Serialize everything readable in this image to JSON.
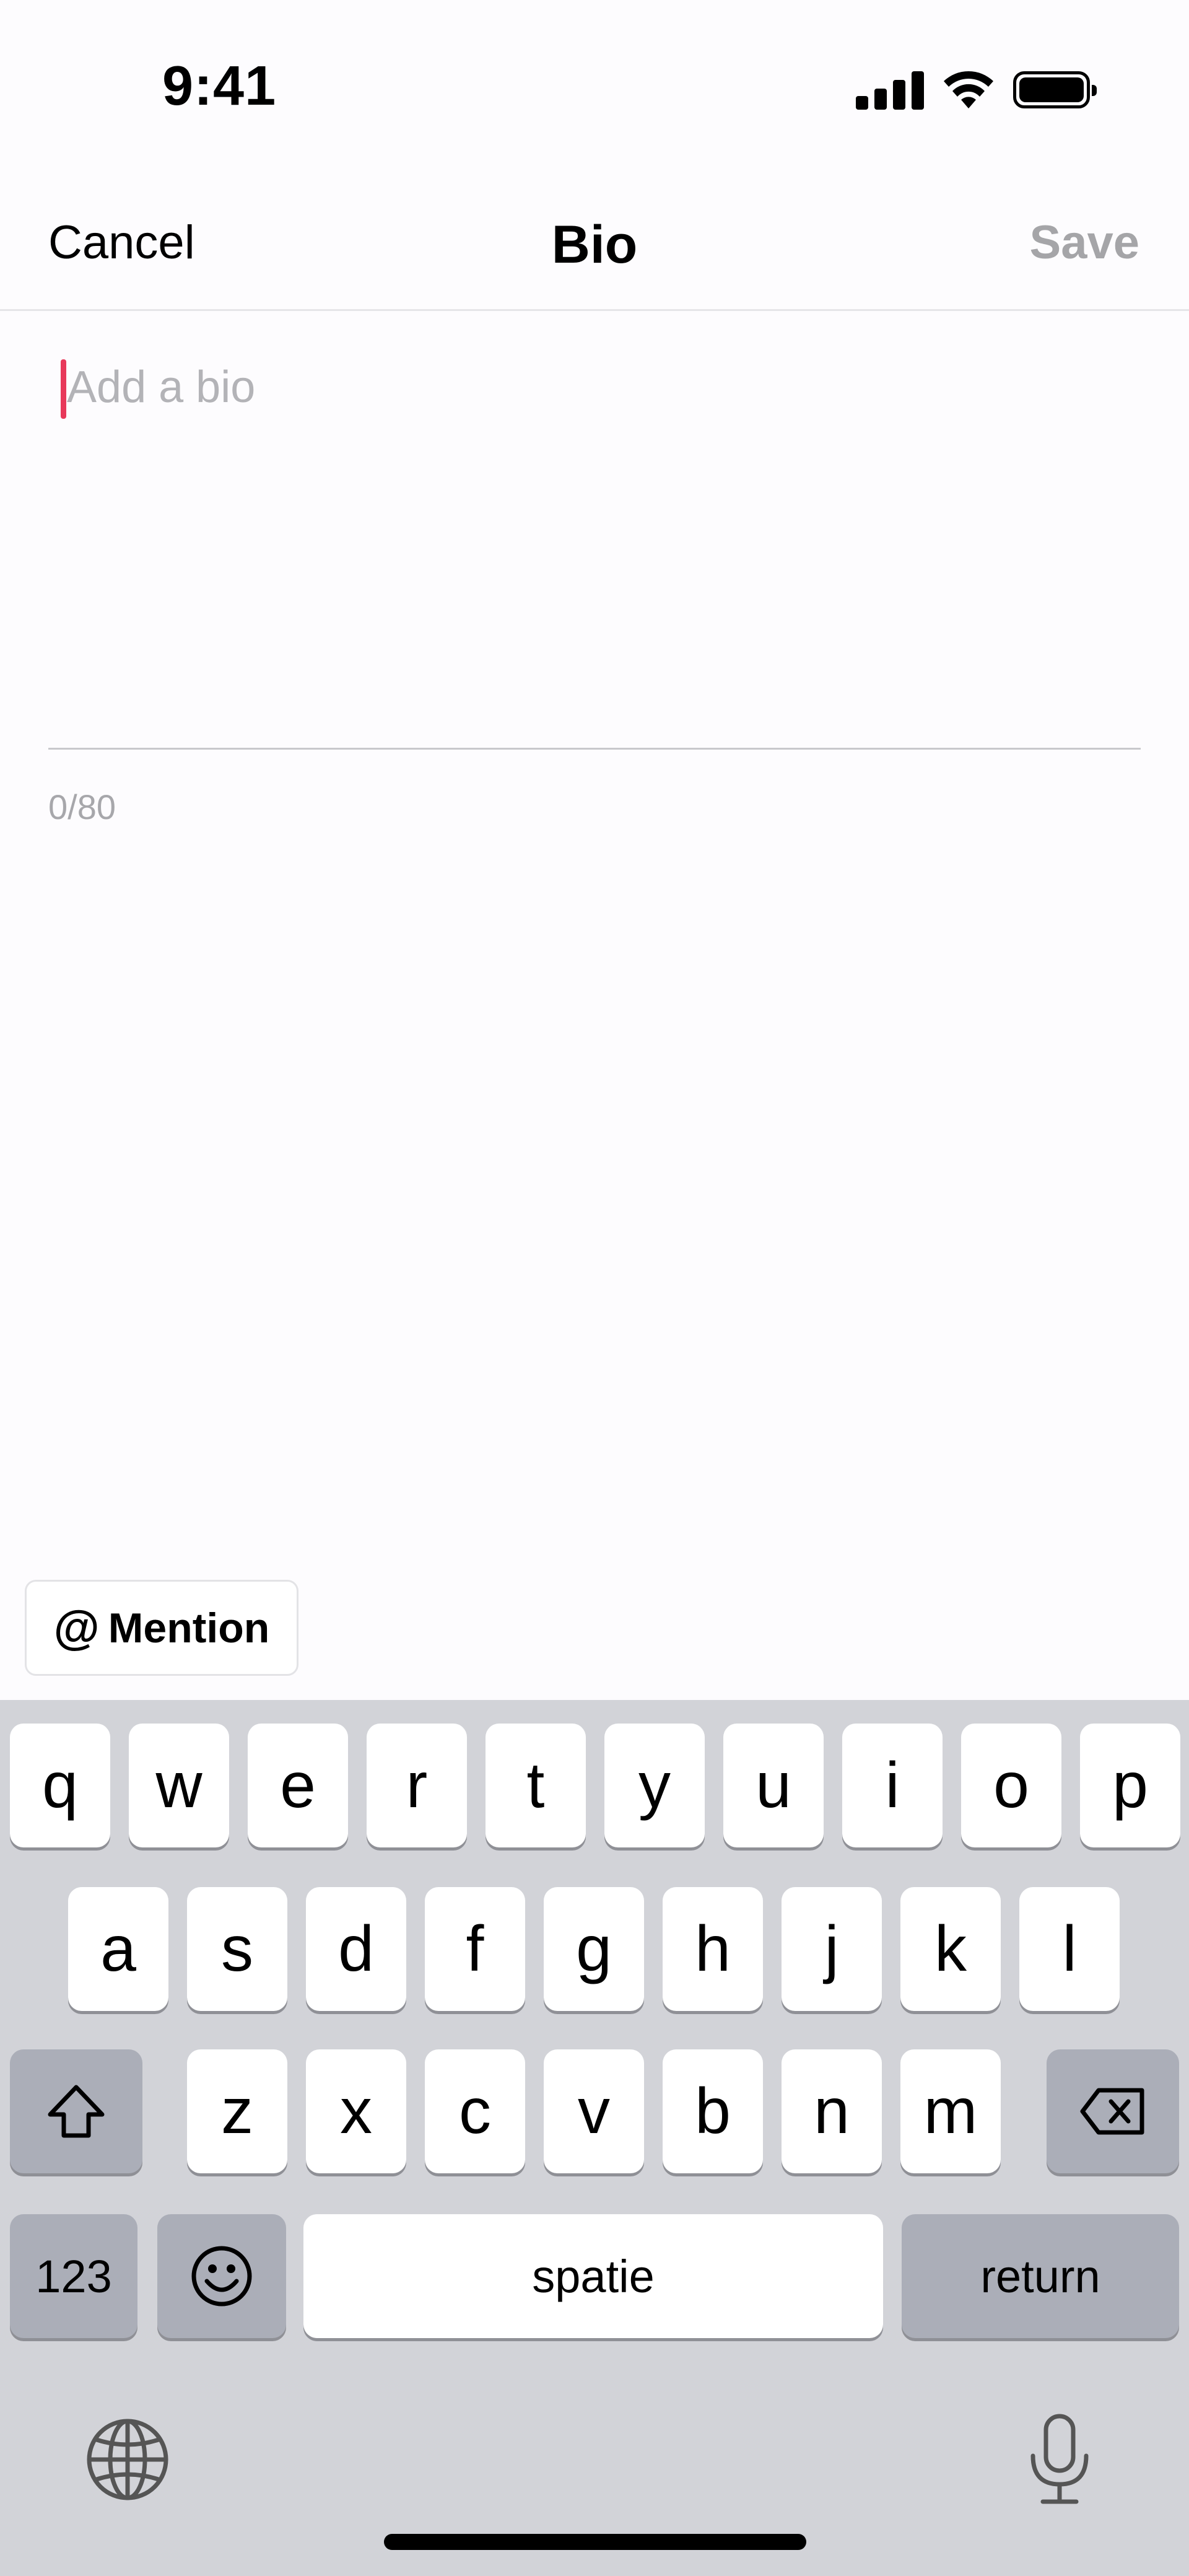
{
  "status_bar": {
    "time": "9:41"
  },
  "nav": {
    "cancel_label": "Cancel",
    "title": "Bio",
    "save_label": "Save"
  },
  "bio": {
    "placeholder": "Add a bio",
    "value": "",
    "char_count": "0/80"
  },
  "mention": {
    "at_symbol": "@",
    "label": "Mention"
  },
  "keyboard": {
    "row1": [
      "q",
      "w",
      "e",
      "r",
      "t",
      "y",
      "u",
      "i",
      "o",
      "p"
    ],
    "row2": [
      "a",
      "s",
      "d",
      "f",
      "g",
      "h",
      "j",
      "k",
      "l"
    ],
    "row3": [
      "z",
      "x",
      "c",
      "v",
      "b",
      "n",
      "m"
    ],
    "numbers_label": "123",
    "space_label": "spatie",
    "return_label": "return"
  },
  "colors": {
    "caret": "#e8395a",
    "save_disabled": "#a5a5a8",
    "keyboard_bg": "#d2d3d8"
  }
}
